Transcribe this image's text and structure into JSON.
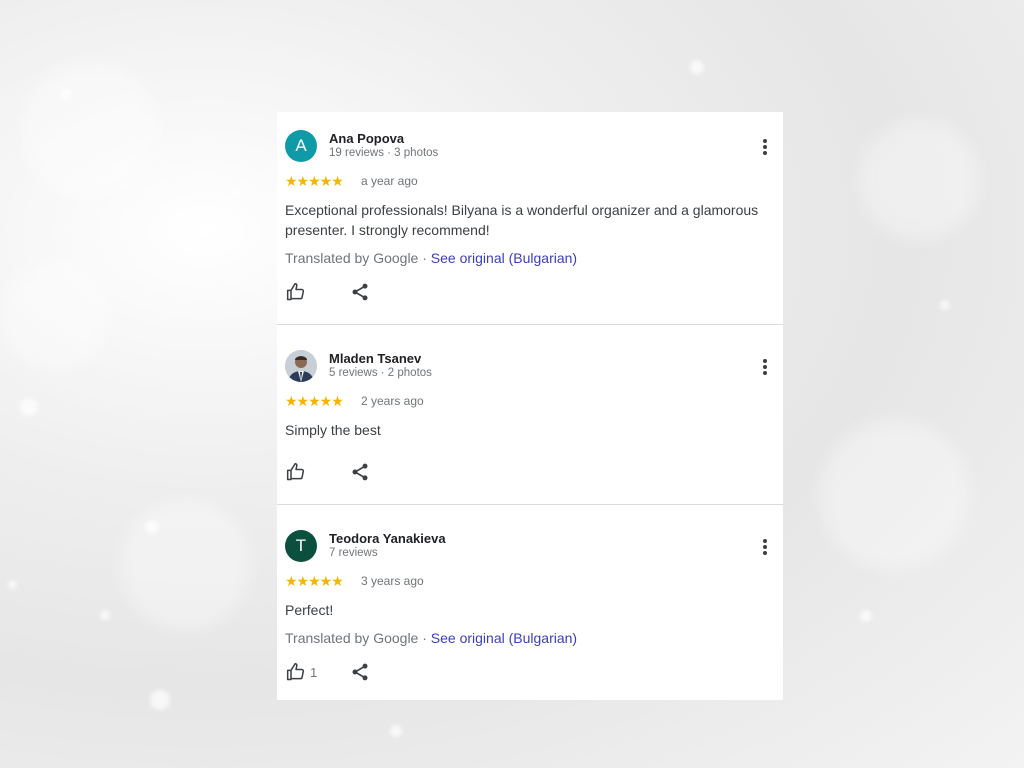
{
  "reviews": [
    {
      "name": "Ana Popova",
      "avatar_letter": "A",
      "avatar_color": "#0f9aa8",
      "meta": "19 reviews · 3 photos",
      "stars": "★★★★★",
      "time": "a year ago",
      "text": "Exceptional professionals! Bilyana is a wonderful organizer and a glamorous presenter. I strongly recommend!",
      "translated_by": "Translated by Google · ",
      "see_original": "See original (Bulgarian)"
    },
    {
      "name": "Mladen Tsanev",
      "meta": "5 reviews · 2 photos",
      "stars": "★★★★★",
      "time": "2 years ago",
      "text": "Simply the best"
    },
    {
      "name": "Teodora Yanakieva",
      "avatar_letter": "T",
      "avatar_color": "#0b4f3f",
      "meta": "7 reviews",
      "stars": "★★★★★",
      "time": "3 years ago",
      "text": "Perfect!",
      "translated_by": "Translated by Google · ",
      "see_original": "See original (Bulgarian)",
      "likes": "1"
    }
  ],
  "colors": {
    "star": "#f5b400",
    "link": "#3c3ebc"
  }
}
